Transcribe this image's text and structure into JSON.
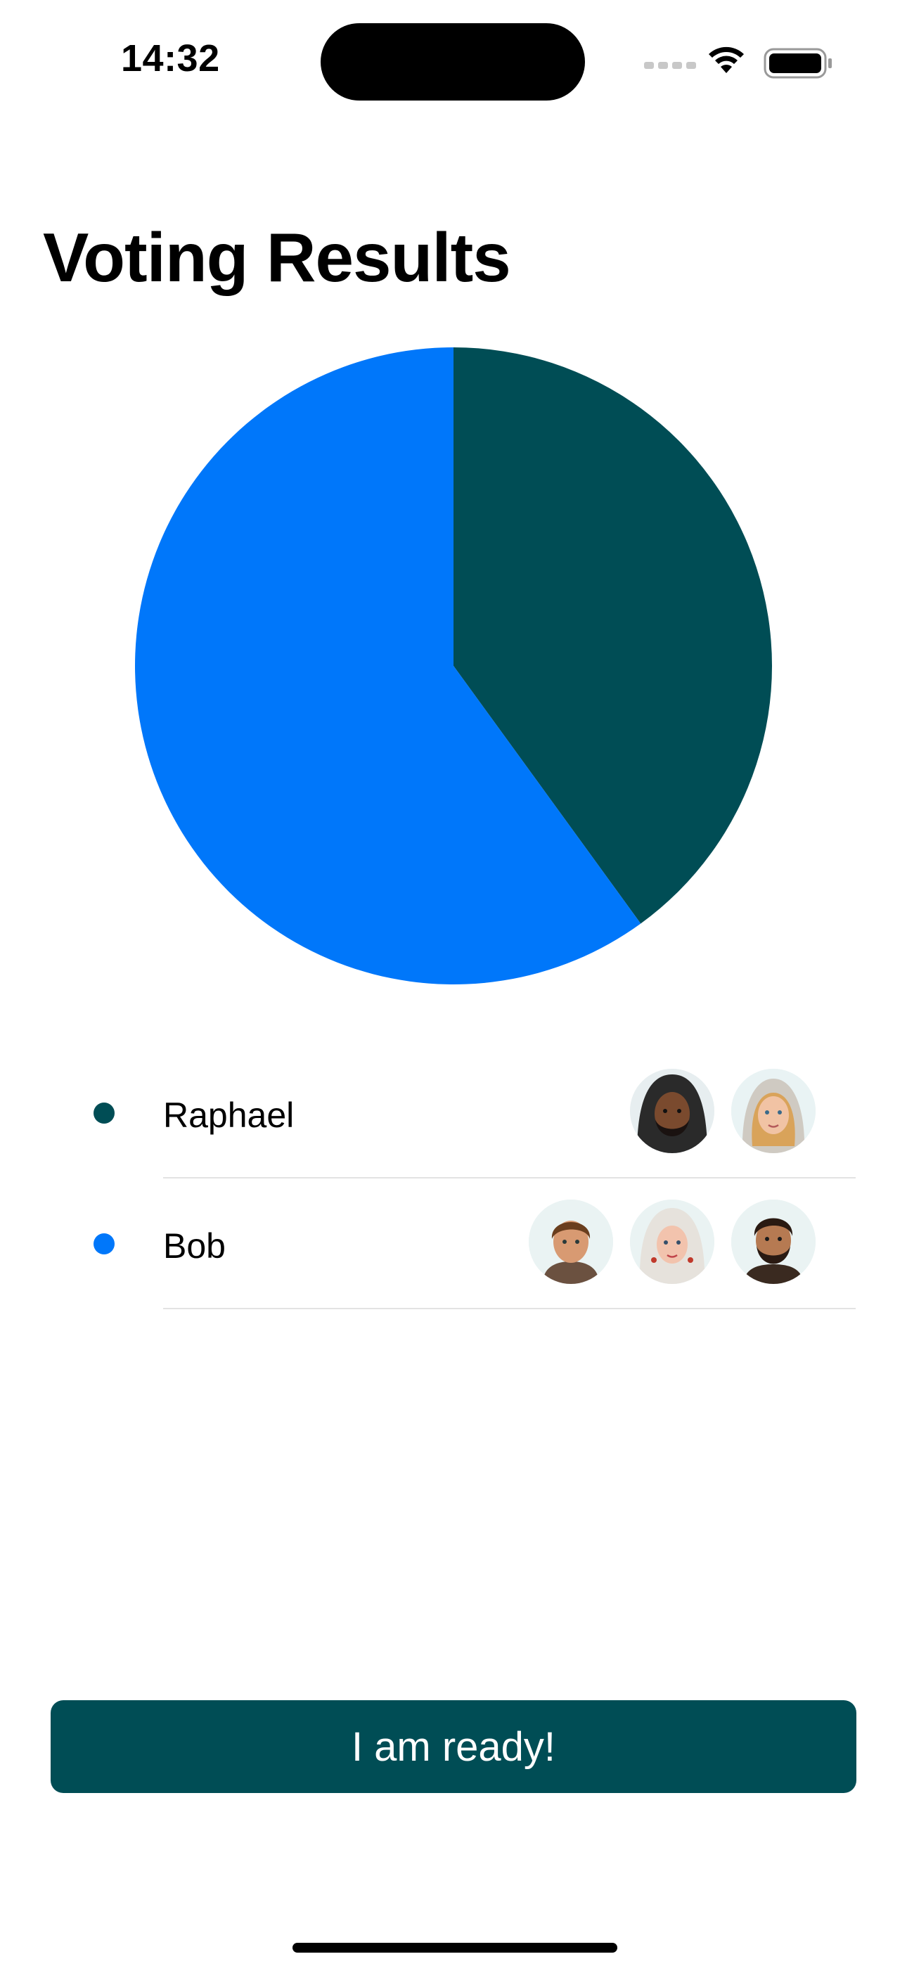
{
  "status_bar": {
    "time": "14:32"
  },
  "title": "Voting Results",
  "colors": {
    "primary": "#004D55",
    "accent": "#0077FA"
  },
  "chart_data": {
    "type": "pie",
    "title": "",
    "slices": [
      {
        "label": "Raphael",
        "value": 2,
        "color": "#004D55"
      },
      {
        "label": "Bob",
        "value": 3,
        "color": "#0077FA"
      }
    ]
  },
  "legend": {
    "items": [
      {
        "name": "Raphael",
        "color": "#004D55",
        "voters": [
          "hooded-man-avatar",
          "blonde-woman-avatar"
        ]
      },
      {
        "name": "Bob",
        "color": "#0077FA",
        "voters": [
          "young-man-avatar",
          "headscarf-woman-avatar",
          "bearded-man-avatar"
        ]
      }
    ]
  },
  "button": {
    "label": "I am ready!"
  }
}
